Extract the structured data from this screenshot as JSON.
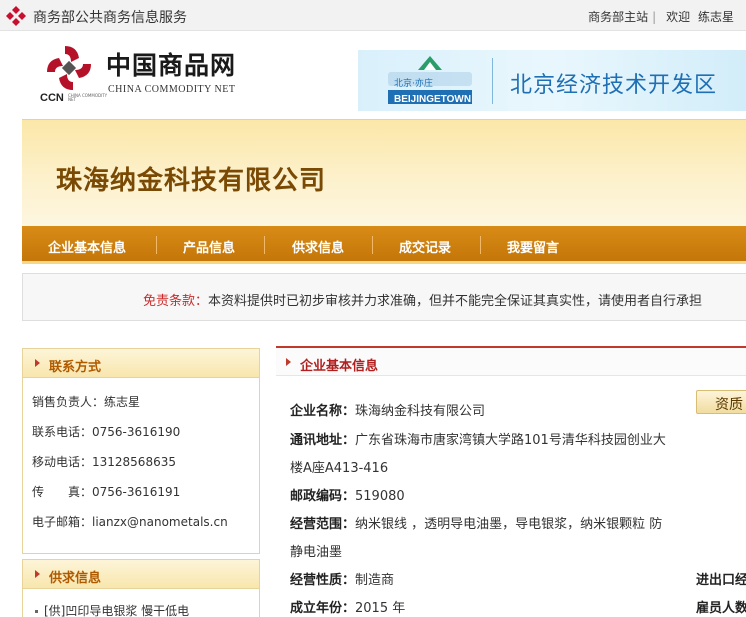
{
  "topbar": {
    "site_name": "商务部公共商务信息服务",
    "home_link": "商务部主站",
    "separator": "|",
    "welcome": "欢迎",
    "user": "练志星"
  },
  "brand": {
    "title": "中国商品网",
    "title_en": "CHINA COMMODITY NET",
    "abbr": "CCN",
    "abbr_sub": "CHINA COMMODITY NET"
  },
  "banner": {
    "city_cn": "北京·亦庄",
    "city_en": "BEIJINGETOWN",
    "zone_name": "北京经济技术开发区"
  },
  "company": {
    "name": "珠海纳金科技有限公司"
  },
  "nav": {
    "items": [
      "企业基本信息",
      "产品信息",
      "供求信息",
      "成交记录",
      "我要留言"
    ]
  },
  "notice": {
    "label": "免责条款：",
    "text": "本资料提供时已初步审核并力求准确，但并不能完全保证其真实性，请使用者自行承担"
  },
  "contact": {
    "title": "联系方式",
    "rows": [
      "销售负责人：练志星",
      "联系电话：0756-3616190",
      "移动电话：13128568635",
      "传　　真：0756-3616191",
      "电子邮箱：lianzx@nanometals.cn"
    ]
  },
  "supply": {
    "title": "供求信息",
    "items": [
      "[供]凹印导电银浆 慢干低电"
    ]
  },
  "info": {
    "title": "企业基本信息",
    "qual_button": "资质",
    "fields": [
      {
        "k": "企业名称：",
        "v": "珠海纳金科技有限公司"
      },
      {
        "k": "通讯地址：",
        "v": "广东省珠海市唐家湾镇大学路101号清华科技园创业大"
      },
      {
        "k": "",
        "v": "楼A座A413-416"
      },
      {
        "k": "邮政编码：",
        "v": "519080"
      },
      {
        "k": "经营范围：",
        "v": "纳米银线 ，透明导电油墨，导电银浆，纳米银颗粒 防"
      },
      {
        "k": "",
        "v": "静电油墨"
      },
      {
        "k": "经营性质：",
        "v": "制造商"
      },
      {
        "k": "成立年份：",
        "v": "2015 年"
      }
    ],
    "right_fields": [
      "进出口经",
      "雇员人数"
    ]
  },
  "colors": {
    "nav_orange": "#c47608",
    "company_brown": "#7a4a05",
    "accent_red": "#c0392b",
    "banner_blue": "#1f6fb5"
  }
}
